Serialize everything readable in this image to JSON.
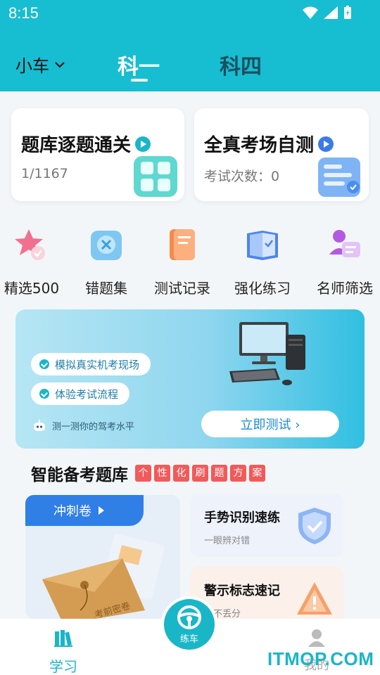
{
  "status": {
    "time": "8:15"
  },
  "header": {
    "car_select": "小车",
    "tabs": [
      {
        "label": "科一"
      },
      {
        "label": "科四"
      }
    ]
  },
  "cards": [
    {
      "title": "题库逐题通关",
      "sub": "1/1167"
    },
    {
      "title": "全真考场自测",
      "sub": "考试次数：0"
    }
  ],
  "quick_icons": [
    {
      "label": "精选500",
      "icon": "star-icon"
    },
    {
      "label": "错题集",
      "icon": "wrong-questions-icon"
    },
    {
      "label": "测试记录",
      "icon": "test-record-icon"
    },
    {
      "label": "强化练习",
      "icon": "book-icon"
    },
    {
      "label": "名师筛选",
      "icon": "teacher-icon"
    }
  ],
  "banner": {
    "pill_1": "模拟真实机考现场",
    "pill_2": "体验考试流程",
    "note": "测一测你的驾考水平",
    "button": "立即测试 ›"
  },
  "section": {
    "title": "智能备考题库",
    "tags": [
      "个",
      "性",
      "化",
      "刷",
      "题",
      "方",
      "案"
    ]
  },
  "sprint": {
    "label": "冲刺卷",
    "envelope_text": "考前密卷"
  },
  "minis": [
    {
      "title": "手势识别速练",
      "sub": "一眼辨对错"
    },
    {
      "title": "警示标志速记",
      "sub": "题不丢分"
    }
  ],
  "bottom_nav": {
    "study": "学习",
    "drive": "练车",
    "me": "我的"
  },
  "watermark": "ITMOP.COM",
  "colors": {
    "accent": "#19b6c8",
    "header": "#17bdd0",
    "tag_red": "#f25a5a",
    "blue": "#2f7fe6"
  }
}
